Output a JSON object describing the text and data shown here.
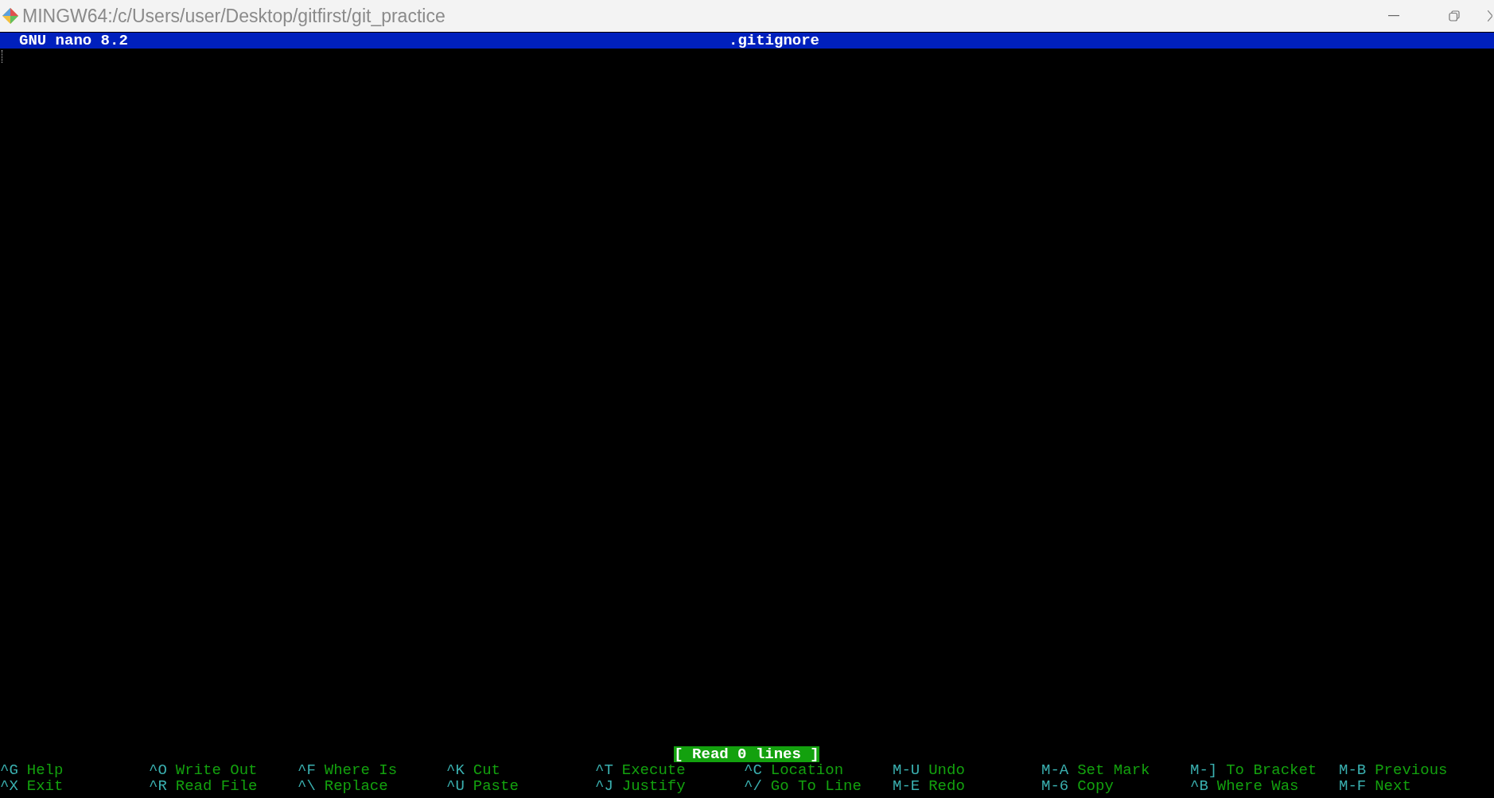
{
  "window": {
    "title": "MINGW64:/c/Users/user/Desktop/gitfirst/git_practice"
  },
  "header": {
    "version": "GNU nano 8.2",
    "filename": ".gitignore"
  },
  "status": "[ Read 0 lines ]",
  "shortcuts": [
    [
      {
        "key": "^G",
        "label": "Help"
      },
      {
        "key": "^O",
        "label": "Write Out"
      },
      {
        "key": "^F",
        "label": "Where Is"
      },
      {
        "key": "^K",
        "label": "Cut"
      },
      {
        "key": "^T",
        "label": "Execute"
      },
      {
        "key": "^C",
        "label": "Location"
      },
      {
        "key": "M-U",
        "label": "Undo"
      },
      {
        "key": "M-A",
        "label": "Set Mark"
      },
      {
        "key": "M-]",
        "label": "To Bracket"
      },
      {
        "key": "M-B",
        "label": "Previous"
      }
    ],
    [
      {
        "key": "^X",
        "label": "Exit"
      },
      {
        "key": "^R",
        "label": "Read File"
      },
      {
        "key": "^\\",
        "label": "Replace"
      },
      {
        "key": "^U",
        "label": "Paste"
      },
      {
        "key": "^J",
        "label": "Justify"
      },
      {
        "key": "^/",
        "label": "Go To Line"
      },
      {
        "key": "M-E",
        "label": "Redo"
      },
      {
        "key": "M-6",
        "label": "Copy"
      },
      {
        "key": "^B",
        "label": "Where Was"
      },
      {
        "key": "M-F",
        "label": "Next"
      }
    ]
  ]
}
